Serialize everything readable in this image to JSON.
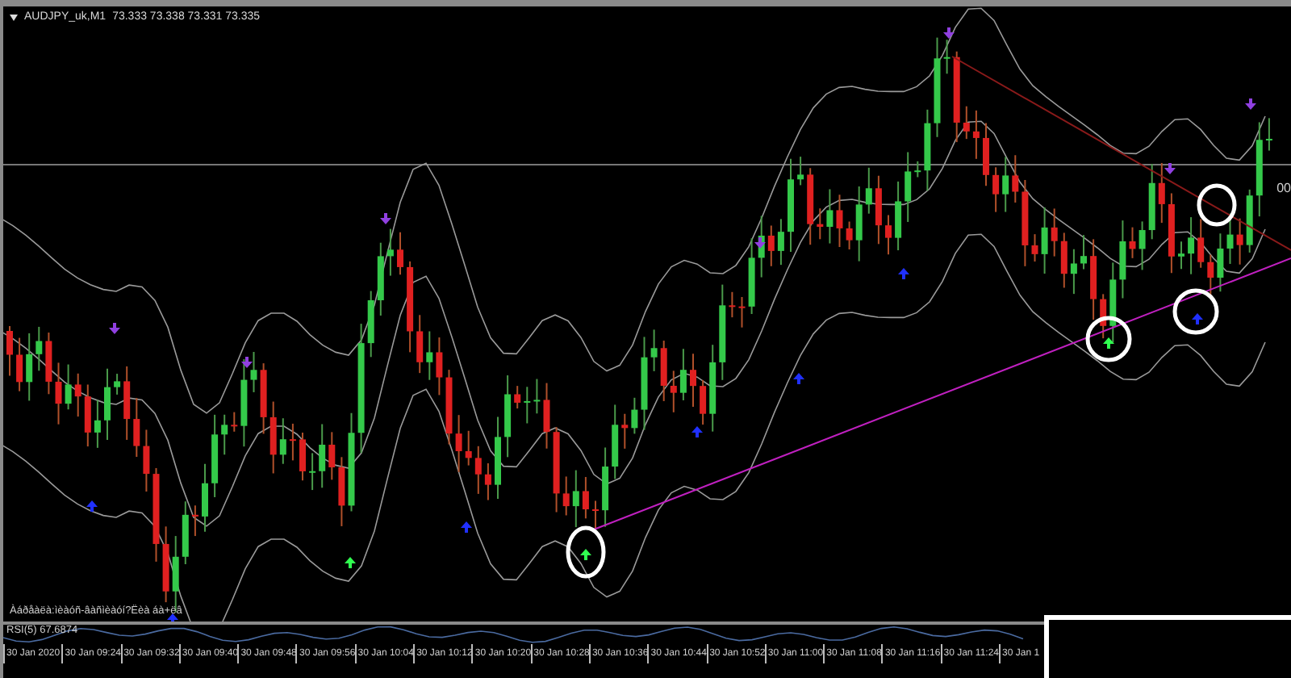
{
  "chart": {
    "symbol": "AUDJPY_uk,M1",
    "quotes": "73.333 73.338 73.331 73.335",
    "price_label": "00",
    "comment": "Àáðåàëà:ìèàóñ-âàñìèàóí?Ëèà áà+ëâ"
  },
  "indicator": {
    "label": "RSI(5) 67.6874"
  },
  "time_axis": [
    "30 Jan 2020",
    "30 Jan 09:24",
    "30 Jan 09:32",
    "30 Jan 09:40",
    "30 Jan 09:48",
    "30 Jan 09:56",
    "30 Jan 10:04",
    "30 Jan 10:12",
    "30 Jan 10:20",
    "30 Jan 10:28",
    "30 Jan 10:36",
    "30 Jan 10:44",
    "30 Jan 10:52",
    "30 Jan 11:00",
    "30 Jan 11:08",
    "30 Jan 11:16",
    "30 Jan 11:24",
    "30 Jan 1"
  ]
}
